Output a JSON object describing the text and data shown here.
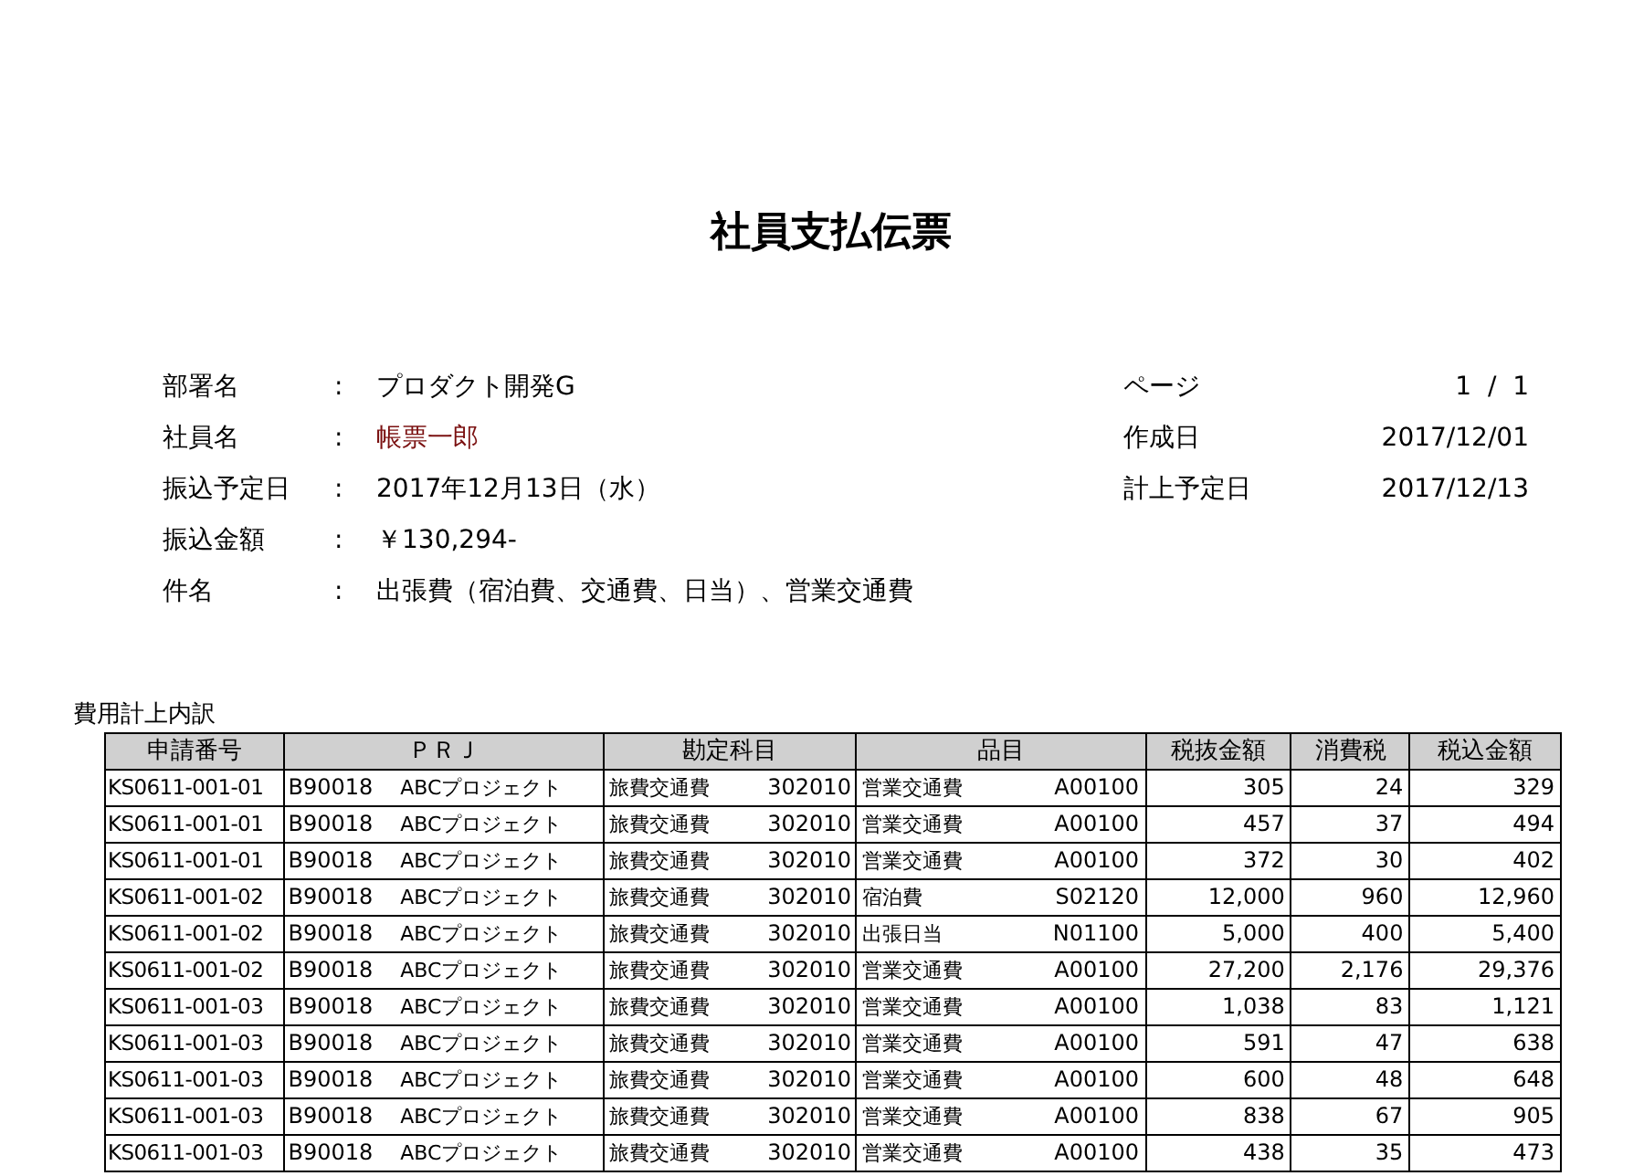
{
  "title": "社員支払伝票",
  "fields": [
    {
      "label": "部署名",
      "separator": ":",
      "value": "プロダクト開発G"
    },
    {
      "label": "社員名",
      "separator": ":",
      "value": "帳票一郎",
      "kind": "name"
    },
    {
      "label": "振込予定日",
      "separator": ":",
      "value": "2017年12月13日（水）"
    },
    {
      "label": "振込金額",
      "separator": ":",
      "value": "￥130,294-"
    },
    {
      "label": "件名",
      "separator": ":",
      "value": "出張費（宿泊費、交通費、日当）、営業交通費"
    }
  ],
  "side_fields": [
    {
      "label": "ページ",
      "value": "1  /  1"
    },
    {
      "label": "作成日",
      "value": "2017/12/01"
    },
    {
      "label": "計上予定日",
      "value": "2017/12/13"
    }
  ],
  "table": {
    "caption": "費用計上内訳",
    "columns": [
      "申請番号",
      "ＰＲＪ",
      "勘定科目",
      "品目",
      "税抜金額",
      "消費税",
      "税込金額"
    ],
    "rows": [
      {
        "request_no": "KS0611-001-01",
        "prj_code": "B90018",
        "prj_name": "ABCプロジェクト",
        "account_name": "旅費交通費",
        "account_code": "302010",
        "item_name": "営業交通費",
        "item_code": "A00100",
        "net": "305",
        "tax": "24",
        "gross": "329"
      },
      {
        "request_no": "KS0611-001-01",
        "prj_code": "B90018",
        "prj_name": "ABCプロジェクト",
        "account_name": "旅費交通費",
        "account_code": "302010",
        "item_name": "営業交通費",
        "item_code": "A00100",
        "net": "457",
        "tax": "37",
        "gross": "494"
      },
      {
        "request_no": "KS0611-001-01",
        "prj_code": "B90018",
        "prj_name": "ABCプロジェクト",
        "account_name": "旅費交通費",
        "account_code": "302010",
        "item_name": "営業交通費",
        "item_code": "A00100",
        "net": "372",
        "tax": "30",
        "gross": "402"
      },
      {
        "request_no": "KS0611-001-02",
        "prj_code": "B90018",
        "prj_name": "ABCプロジェクト",
        "account_name": "旅費交通費",
        "account_code": "302010",
        "item_name": "宿泊費",
        "item_code": "S02120",
        "net": "12,000",
        "tax": "960",
        "gross": "12,960"
      },
      {
        "request_no": "KS0611-001-02",
        "prj_code": "B90018",
        "prj_name": "ABCプロジェクト",
        "account_name": "旅費交通費",
        "account_code": "302010",
        "item_name": "出張日当",
        "item_code": "N01100",
        "net": "5,000",
        "tax": "400",
        "gross": "5,400"
      },
      {
        "request_no": "KS0611-001-02",
        "prj_code": "B90018",
        "prj_name": "ABCプロジェクト",
        "account_name": "旅費交通費",
        "account_code": "302010",
        "item_name": "営業交通費",
        "item_code": "A00100",
        "net": "27,200",
        "tax": "2,176",
        "gross": "29,376"
      },
      {
        "request_no": "KS0611-001-03",
        "prj_code": "B90018",
        "prj_name": "ABCプロジェクト",
        "account_name": "旅費交通費",
        "account_code": "302010",
        "item_name": "営業交通費",
        "item_code": "A00100",
        "net": "1,038",
        "tax": "83",
        "gross": "1,121"
      },
      {
        "request_no": "KS0611-001-03",
        "prj_code": "B90018",
        "prj_name": "ABCプロジェクト",
        "account_name": "旅費交通費",
        "account_code": "302010",
        "item_name": "営業交通費",
        "item_code": "A00100",
        "net": "591",
        "tax": "47",
        "gross": "638"
      },
      {
        "request_no": "KS0611-001-03",
        "prj_code": "B90018",
        "prj_name": "ABCプロジェクト",
        "account_name": "旅費交通費",
        "account_code": "302010",
        "item_name": "営業交通費",
        "item_code": "A00100",
        "net": "600",
        "tax": "48",
        "gross": "648"
      },
      {
        "request_no": "KS0611-001-03",
        "prj_code": "B90018",
        "prj_name": "ABCプロジェクト",
        "account_name": "旅費交通費",
        "account_code": "302010",
        "item_name": "営業交通費",
        "item_code": "A00100",
        "net": "838",
        "tax": "67",
        "gross": "905"
      },
      {
        "request_no": "KS0611-001-03",
        "prj_code": "B90018",
        "prj_name": "ABCプロジェクト",
        "account_name": "旅費交通費",
        "account_code": "302010",
        "item_name": "営業交通費",
        "item_code": "A00100",
        "net": "438",
        "tax": "35",
        "gross": "473"
      }
    ]
  }
}
